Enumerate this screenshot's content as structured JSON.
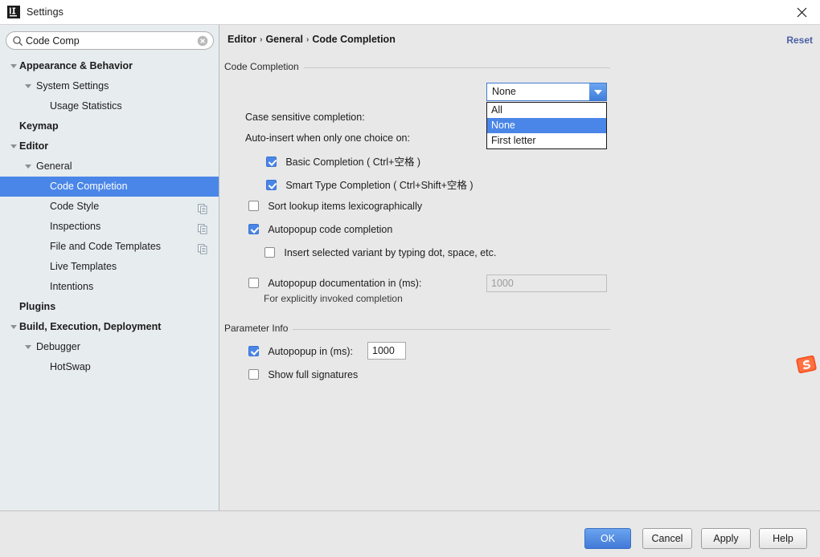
{
  "window": {
    "title": "Settings",
    "icon": "intellij-idea-icon",
    "close_icon": "close-icon"
  },
  "sidebar": {
    "search": {
      "value": "Code Comp",
      "placeholder": "Search settings",
      "search_icon": "search-icon",
      "clear_icon": "clear-circle-icon"
    },
    "items": [
      {
        "label": "Appearance & Behavior",
        "indent": 0,
        "bold": true,
        "expanded": true,
        "arrow": true,
        "selected": false,
        "copy_icon": false
      },
      {
        "label": "System Settings",
        "indent": 1,
        "bold": false,
        "expanded": true,
        "arrow": true,
        "selected": false,
        "copy_icon": false
      },
      {
        "label": "Usage Statistics",
        "indent": 2,
        "bold": false,
        "expanded": false,
        "arrow": false,
        "selected": false,
        "copy_icon": false
      },
      {
        "label": "Keymap",
        "indent": 0,
        "bold": true,
        "expanded": false,
        "arrow": false,
        "selected": false,
        "copy_icon": false
      },
      {
        "label": "Editor",
        "indent": 0,
        "bold": true,
        "expanded": true,
        "arrow": true,
        "selected": false,
        "copy_icon": false
      },
      {
        "label": "General",
        "indent": 1,
        "bold": false,
        "expanded": true,
        "arrow": true,
        "selected": false,
        "copy_icon": false
      },
      {
        "label": "Code Completion",
        "indent": 2,
        "bold": false,
        "expanded": false,
        "arrow": false,
        "selected": true,
        "copy_icon": false
      },
      {
        "label": "Code Style",
        "indent": 2,
        "bold": false,
        "expanded": false,
        "arrow": false,
        "selected": false,
        "copy_icon": true
      },
      {
        "label": "Inspections",
        "indent": 2,
        "bold": false,
        "expanded": false,
        "arrow": false,
        "selected": false,
        "copy_icon": true
      },
      {
        "label": "File and Code Templates",
        "indent": 2,
        "bold": false,
        "expanded": false,
        "arrow": false,
        "selected": false,
        "copy_icon": true
      },
      {
        "label": "Live Templates",
        "indent": 2,
        "bold": false,
        "expanded": false,
        "arrow": false,
        "selected": false,
        "copy_icon": false
      },
      {
        "label": "Intentions",
        "indent": 2,
        "bold": false,
        "expanded": false,
        "arrow": false,
        "selected": false,
        "copy_icon": false
      },
      {
        "label": "Plugins",
        "indent": 0,
        "bold": true,
        "expanded": false,
        "arrow": false,
        "selected": false,
        "copy_icon": false
      },
      {
        "label": "Build, Execution, Deployment",
        "indent": 0,
        "bold": true,
        "expanded": true,
        "arrow": true,
        "selected": false,
        "copy_icon": false
      },
      {
        "label": "Debugger",
        "indent": 1,
        "bold": false,
        "expanded": true,
        "arrow": true,
        "selected": false,
        "copy_icon": false
      },
      {
        "label": "HotSwap",
        "indent": 2,
        "bold": false,
        "expanded": false,
        "arrow": false,
        "selected": false,
        "copy_icon": false
      }
    ]
  },
  "main": {
    "breadcrumb": {
      "parts": [
        "Editor",
        "General",
        "Code Completion"
      ],
      "separator": "›"
    },
    "reset_label": "Reset",
    "code_completion": {
      "group_title": "Code Completion",
      "case_sensitive_label": "Case sensitive completion:",
      "case_sensitive_value": "None",
      "case_sensitive_options": [
        "All",
        "None",
        "First letter"
      ],
      "case_sensitive_selected_index": 1,
      "auto_insert_label": "Auto-insert when only one choice on:",
      "basic_completion_label": "Basic Completion ( Ctrl+空格 )",
      "basic_completion_checked": true,
      "smart_type_label": "Smart Type Completion ( Ctrl+Shift+空格 )",
      "smart_type_checked": true,
      "sort_lookup_label": "Sort lookup items lexicographically",
      "sort_lookup_checked": false,
      "autopopup_code_label": "Autopopup code completion",
      "autopopup_code_checked": true,
      "insert_variant_label": "Insert selected variant by typing dot, space, etc.",
      "insert_variant_checked": false,
      "autopopup_doc_label": "Autopopup documentation in (ms):",
      "autopopup_doc_checked": false,
      "autopopup_doc_value": "1000",
      "autopopup_doc_hint": "For explicitly invoked completion"
    },
    "parameter_info": {
      "group_title": "Parameter Info",
      "autopopup_label": "Autopopup in (ms):",
      "autopopup_checked": true,
      "autopopup_value": "1000",
      "show_full_signatures_label": "Show full signatures",
      "show_full_signatures_checked": false
    }
  },
  "footer": {
    "buttons": [
      {
        "label": "OK",
        "primary": true
      },
      {
        "label": "Cancel",
        "primary": false
      },
      {
        "label": "Apply",
        "primary": false
      },
      {
        "label": "Help",
        "primary": false
      }
    ]
  },
  "overlay": {
    "ime_badge": "sogou-ime-icon"
  },
  "colors": {
    "accent": "#4a86e8",
    "selection": "#4a86e8",
    "sidebar_bg": "#e7ecef",
    "panel_bg": "#e8e8e8",
    "link": "#4a5fa5",
    "ime_orange": "#f4511e"
  }
}
